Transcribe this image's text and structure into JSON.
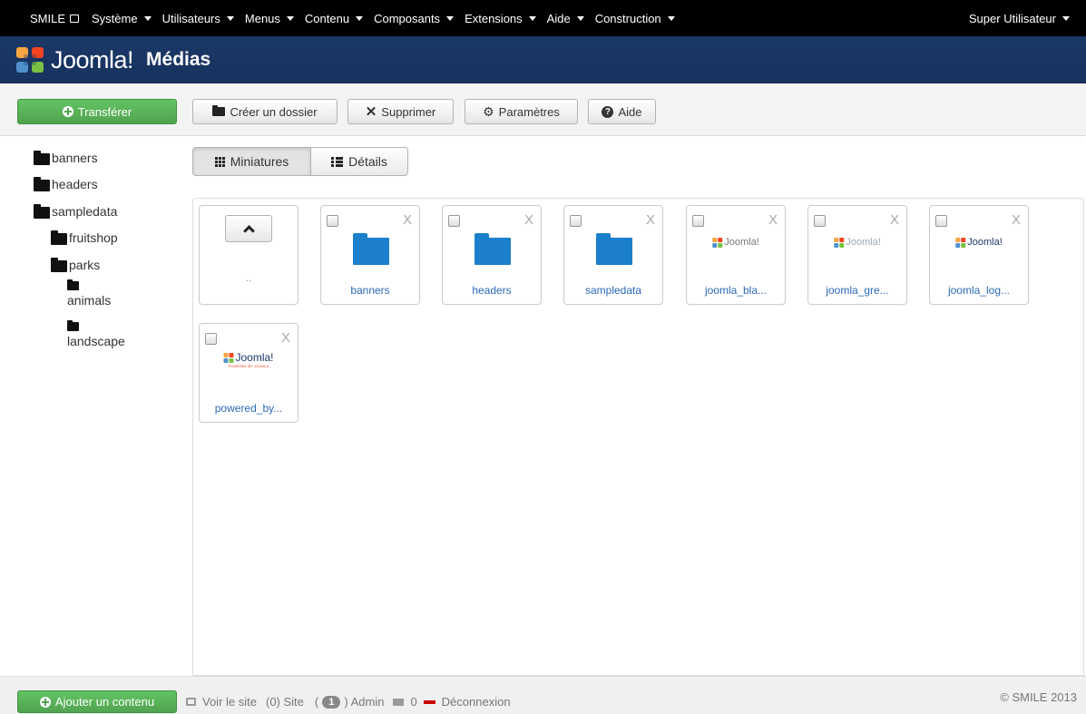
{
  "navbar": {
    "brand": "SMILE",
    "menu": [
      "Système",
      "Utilisateurs",
      "Menus",
      "Contenu",
      "Composants",
      "Extensions",
      "Aide",
      "Construction"
    ],
    "user": "Super Utilisateur"
  },
  "header": {
    "logo_text": "Joomla!",
    "title": "Médias"
  },
  "toolbar": {
    "upload": "Transférer",
    "create_folder": "Créer un dossier",
    "delete": "Supprimer",
    "settings": "Paramètres",
    "help": "Aide"
  },
  "tree": {
    "banners": "banners",
    "headers": "headers",
    "sampledata": "sampledata",
    "fruitshop": "fruitshop",
    "parks": "parks",
    "animals": "animals",
    "landscape": "landscape"
  },
  "view": {
    "thumbnails": "Miniatures",
    "details": "Détails"
  },
  "media": {
    "up_dots": "..",
    "close_glyph": "X",
    "items": [
      "banners",
      "headers",
      "sampledata",
      "joomla_bla...",
      "joomla_gre...",
      "joomla_log...",
      "powered_by..."
    ],
    "logo_word": "Joomla!",
    "powered_caption": "POWERED BY JOOMLA"
  },
  "footer": {
    "add_content": "Ajouter un contenu",
    "view_site": "Voir le site",
    "site_count": "(0) Site",
    "admin_open": "(",
    "admin_badge": "1",
    "admin_close": ") Admin",
    "messages": "0",
    "logout": "Déconnexion",
    "copyright": "© SMILE 2013"
  }
}
